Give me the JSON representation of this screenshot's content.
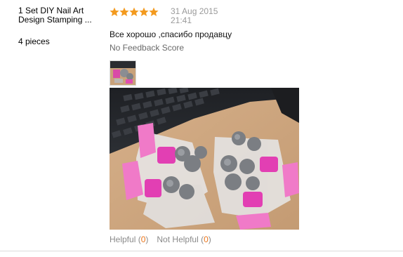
{
  "product": {
    "title_line1": "1 Set DIY Nail Art",
    "title_line2": "Design Stamping ...",
    "quantity": "4 pieces"
  },
  "review": {
    "rating": 5,
    "rating_max": 5,
    "star_color": "#f39a1e",
    "date": "31 Aug 2015",
    "time": "21:41",
    "comment": "Все хорошо ,спасибо продавцу",
    "feedback_score": "No Feedback Score"
  },
  "feedback": {
    "helpful_label": "Helpful",
    "helpful_count": "0",
    "not_helpful_label": "Not Helpful",
    "not_helpful_count": "0"
  }
}
